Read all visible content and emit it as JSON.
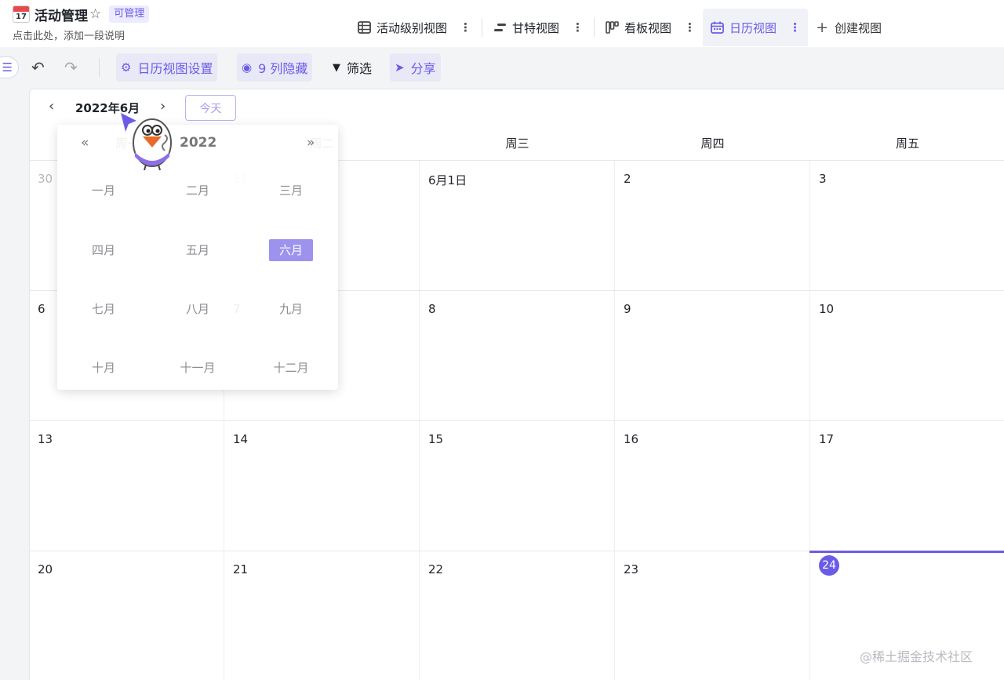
{
  "header": {
    "title": "活动管理",
    "calendar_emoji_number": "17",
    "badge": "可管理",
    "subtitle": "点击此处，添加一段说明",
    "view_tabs": [
      {
        "label": "活动级别视图",
        "icon": "table-icon"
      },
      {
        "label": "甘特视图",
        "icon": "gantt-icon"
      },
      {
        "label": "看板视图",
        "icon": "kanban-icon"
      },
      {
        "label": "日历视图",
        "icon": "calendar-icon",
        "active": true
      }
    ],
    "add_view": "创建视图"
  },
  "toolbar": {
    "calendar_settings": "日历视图设置",
    "hidden_columns": "9 列隐藏",
    "filter": "筛选",
    "share": "分享"
  },
  "calendar": {
    "current_month": "2022年6月",
    "today_button": "今天",
    "weekdays": [
      "周一",
      "周二",
      "周三",
      "周四",
      "周五"
    ],
    "weeks": [
      [
        "30",
        "31",
        "6月1日",
        "2",
        "3"
      ],
      [
        "6",
        "7",
        "8",
        "9",
        "10"
      ],
      [
        "13",
        "14",
        "15",
        "16",
        "17"
      ],
      [
        "20",
        "21",
        "22",
        "23",
        "24"
      ]
    ],
    "today": "24",
    "accent_color": "#6b5ce7"
  },
  "month_picker": {
    "year": "2022",
    "prev": "«",
    "next": "»",
    "months": [
      "一月",
      "二月",
      "三月",
      "四月",
      "五月",
      "六月",
      "七月",
      "八月",
      "九月",
      "十月",
      "十一月",
      "十二月"
    ],
    "selected": "六月"
  },
  "watermark": "@稀土掘金技术社区"
}
